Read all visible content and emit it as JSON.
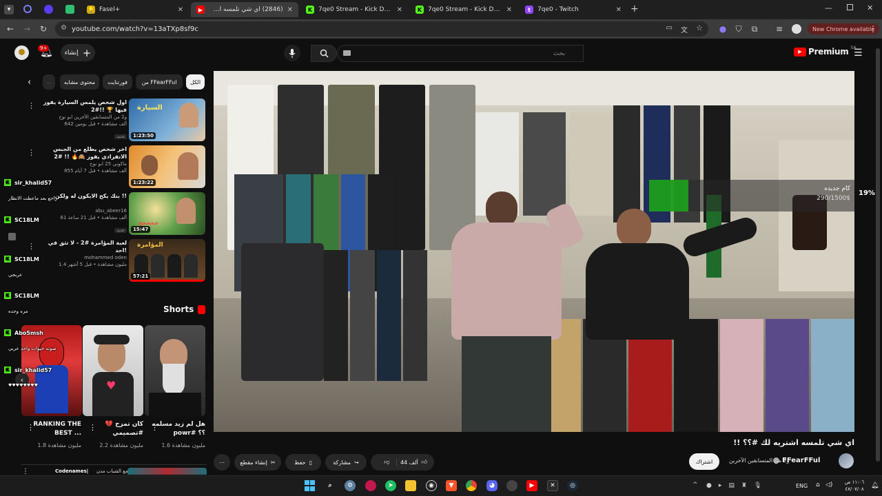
{
  "browser": {
    "tabs": [
      {
        "title": "Fasel+",
        "icon": "lightbulb-icon"
      },
      {
        "title": "(2846) اي شي تلمسه اشتريه لك",
        "icon": "youtube-icon"
      },
      {
        "title": "7qe0 Stream - Kick Dashboard",
        "icon": "kick-icon"
      },
      {
        "title": "7qe0 Stream - Kick Dashboard",
        "icon": "kick-icon"
      },
      {
        "title": "7qe0 - Twitch",
        "icon": "twitch-icon"
      }
    ],
    "url": "youtube.com/watch?v=13aTXp8sf9c",
    "new_chrome": "New Chrome available"
  },
  "youtube": {
    "create_label": "إنشاء",
    "notif_count": "9+",
    "search_placeholder": "بحث",
    "premium": "Premium",
    "region": "SA"
  },
  "chips": [
    "الكل",
    "من FFearFFul",
    "فورتنايت",
    "محتوى مشابه"
  ],
  "related": [
    {
      "title": "اول شخص يلمس السيارة يفوز فيها 🏆 !!#2",
      "channel": "ابو نوح",
      "meta1": "و2 من المتسابقين الآخرين",
      "views": "642 ألف مشاهدة • قبل يومين",
      "badge": "جديد",
      "duration": "1:23:50"
    },
    {
      "title": "اخر شخص يطلع من الجبس الانفرادي يفوز 🙈🔥 !! #2",
      "channel": "ابو نوح",
      "meta1": "ماكوني 25",
      "views": "855 ألف مشاهدة • قبل 7 أيام",
      "badge": "",
      "duration": "1:23:22"
    },
    {
      "title": "بنك يكح الايكون له ولكن !!",
      "channel": "abu_abeer16",
      "meta1": "",
      "views": "61 ألف مشاهدة • قبل 21 ساعة",
      "badge": "جديد",
      "duration": "15:47"
    },
    {
      "title": "لعبة المؤامرة #2 - لا تثق في احد!",
      "channel": "mohammed oden",
      "meta1": "",
      "views": "1.4 مليون مشاهدة • قبل 5 أشهر",
      "badge": "",
      "duration": "57:21"
    }
  ],
  "chat": [
    {
      "user": "sir_khalid57",
      "msg": "راجع بعد ماعطت الانظار"
    },
    {
      "user": "SC18LM",
      "msg": ""
    },
    {
      "user": "SC18LM",
      "msg": "عربجي"
    },
    {
      "user": "SC18LM",
      "msg": "مره وحده"
    },
    {
      "user": "Abo5msh",
      "msg": "صوته حيوات واحد عربي"
    },
    {
      "user": "sir_khalid57",
      "msg": "♥♥♥♥♥♥♥♥"
    }
  ],
  "shorts_header": "Shorts",
  "shorts": [
    {
      "title": "RANKING THE BEST ...",
      "views": "1.8 مليون مشاهدة"
    },
    {
      "title": "كان تمزح 💔 #تصميمي #بادري...",
      "views": "2.2 مليون مشاهدة"
    },
    {
      "title": "هل لم زيد مسلمه powr# ؟؟",
      "views": "1.6 مليون مشاهدة"
    }
  ],
  "bottom_row": {
    "channel": "Codenames|",
    "text": "كود تكس مع الشباب مدن"
  },
  "video": {
    "title": "اي شي تلمسه اشتريه لك #؟؟ !!",
    "overlay_goal_title": "كام جديده",
    "overlay_goal_amount": "290/1500$",
    "overlay_percent": "19%",
    "goal_progress": 0.19
  },
  "actions": {
    "likes": "44 ألف",
    "share": "مشاركة",
    "save": "حفظ",
    "clip": "إنشاء مقطع",
    "subscribe": "اشتراك",
    "channel": "FFearFFul",
    "collab": "و2 من المتسابقين الآخرين"
  },
  "taskbar": {
    "lang": "ENG",
    "time": "١١:٠٦ ص",
    "date": "٤٧/٠٧/٠٨"
  },
  "colors": {
    "accent_red": "#ff0000",
    "kick_green": "#53fc18"
  }
}
